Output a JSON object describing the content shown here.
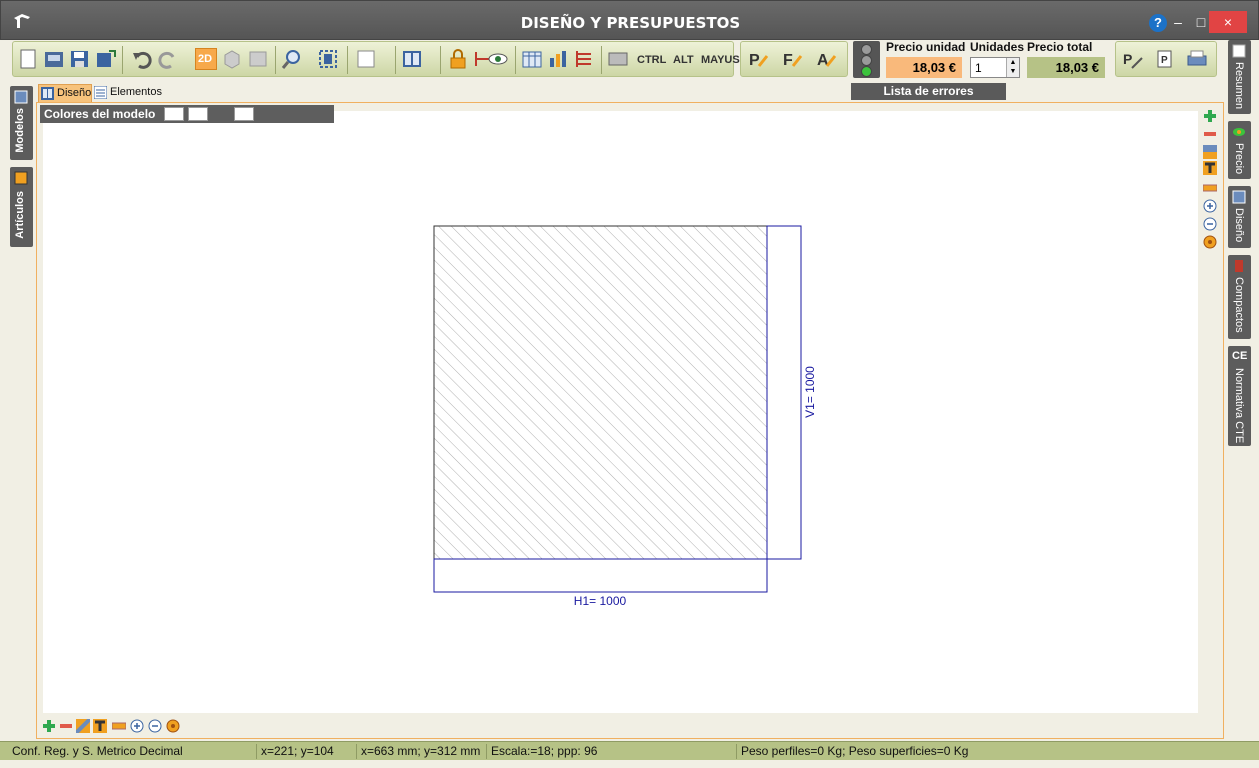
{
  "window": {
    "title": "DISEÑO Y PRESUPUESTOS",
    "help": "?",
    "minimize": "–",
    "maximize": "□",
    "close": "×"
  },
  "toolbar": {
    "view_2d": "2D",
    "key_ctrl": "CTRL",
    "key_alt": "ALT",
    "key_mayus": "MAYUS"
  },
  "pricing": {
    "unit_price_label": "Precio unidad",
    "unit_price_value": "18,03 €",
    "units_label": "Unidades",
    "units_value": "1",
    "total_price_label": "Precio total",
    "total_price_value": "18,03 €",
    "errors_label": "Lista de errores"
  },
  "left_tabs": [
    "Modelos",
    "Artículos"
  ],
  "right_tabs": [
    "Resumen",
    "Precio",
    "Diseño",
    "Compactos",
    "Normativa CTE"
  ],
  "subtabs": [
    "Diseño",
    "Elementos"
  ],
  "colors_bar": {
    "label": "Colores del modelo"
  },
  "drawing": {
    "h_dimension": "H1= 1000",
    "v_dimension": "V1= 1000",
    "stroke_color": "#1a1aa0"
  },
  "status": {
    "config": "Conf. Reg. y S. Metrico Decimal",
    "cursor_px": "x=221; y=104",
    "cursor_mm": "x=663 mm; y=312 mm",
    "scale": "Escala:=18; ppp: 96",
    "weight": "Peso perfiles=0 Kg; Peso superficies=0 Kg"
  },
  "colors": {
    "accent_orange": "#f7c37c",
    "status_green": "#b6c286",
    "title_gray": "#5a5a5a"
  }
}
